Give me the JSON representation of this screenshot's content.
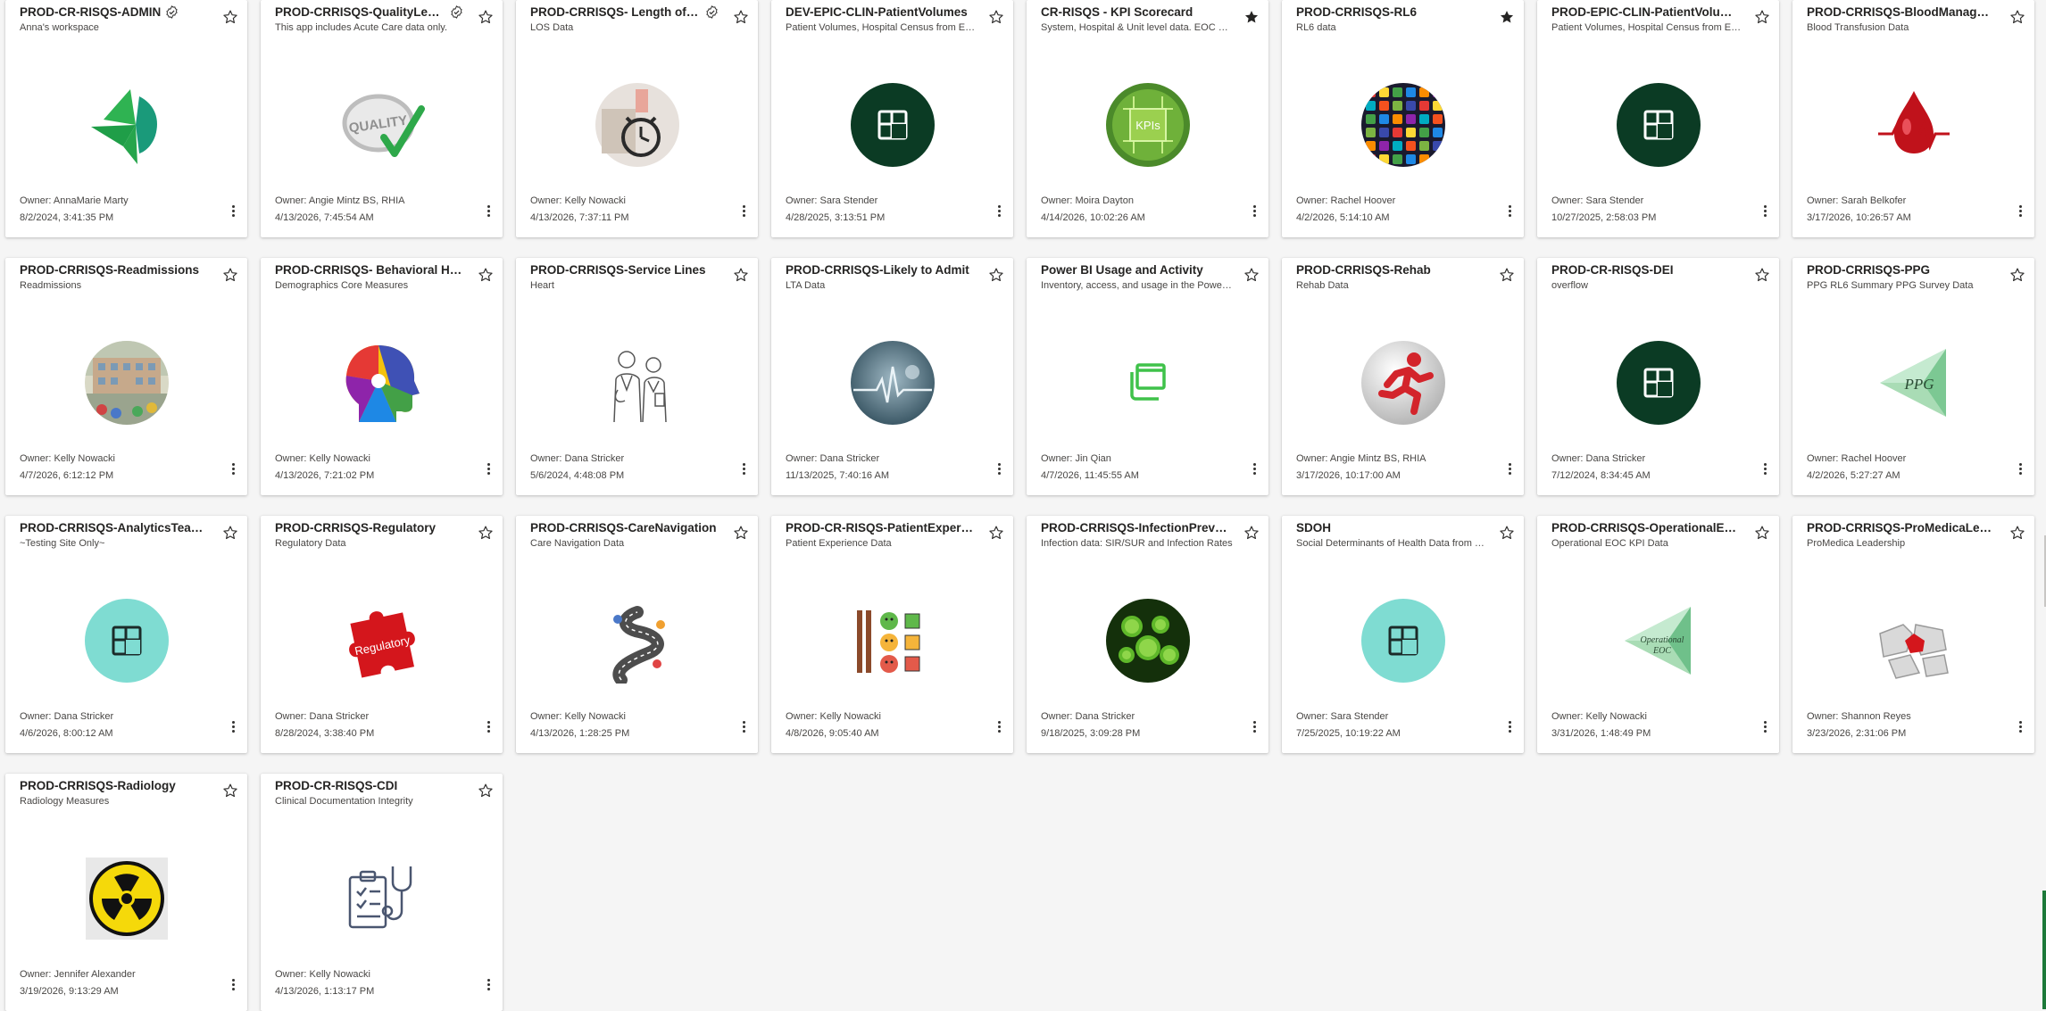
{
  "labels": {
    "owner_prefix": "Owner: "
  },
  "apps": [
    {
      "title": "PROD-CR-RISQS-ADMIN",
      "certified": true,
      "favorite": false,
      "description": "Anna's workspace",
      "owner": "AnnaMarie Marty",
      "date": "8/2/2024, 3:41:35 PM",
      "icon": "green-arrow-logo-icon"
    },
    {
      "title": "PROD-CRRISQS-QualityLeads",
      "certified": true,
      "favorite": false,
      "description": "This app includes Acute Care data only.",
      "owner": "Angie Mintz BS, RHIA",
      "date": "4/13/2026, 7:45:54 AM",
      "icon": "quality-checkmark-icon"
    },
    {
      "title": "PROD-CRRISQS- Length of Stay",
      "certified": true,
      "favorite": false,
      "description": "LOS Data",
      "owner": "Kelly Nowacki",
      "date": "4/13/2026, 7:37:11 PM",
      "icon": "alarm-clock-photo-icon"
    },
    {
      "title": "DEV-EPIC-CLIN-PatientVolumes",
      "certified": false,
      "favorite": false,
      "description": "Patient Volumes, Hospital Census from Epic",
      "owner": "Sara Stender",
      "date": "4/28/2025, 3:13:51 PM",
      "icon": "app-default-dark-icon"
    },
    {
      "title": "CR-RISQS - KPI Scorecard",
      "certified": false,
      "favorite": true,
      "description": "System, Hospital & Unit level data. EOC Reports",
      "owner": "Moira Dayton",
      "date": "4/14/2026, 10:02:26 AM",
      "icon": "kpi-chip-icon"
    },
    {
      "title": "PROD-CRRISQS-RL6",
      "certified": false,
      "favorite": true,
      "description": "RL6 data",
      "owner": "Rachel Hoover",
      "date": "4/2/2026, 5:14:10 AM",
      "icon": "app-grid-photo-icon"
    },
    {
      "title": "PROD-EPIC-CLIN-PatientVolumes",
      "certified": false,
      "favorite": false,
      "description": "Patient Volumes, Hospital Census from Epic",
      "owner": "Sara Stender",
      "date": "10/27/2025, 2:58:03 PM",
      "icon": "app-default-dark-icon"
    },
    {
      "title": "PROD-CRRISQS-BloodManagement",
      "certified": false,
      "favorite": false,
      "description": "Blood Transfusion Data",
      "owner": "Sarah Belkofer",
      "date": "3/17/2026, 10:26:57 AM",
      "icon": "blood-drop-icon"
    },
    {
      "title": "PROD-CRRISQS-Readmissions",
      "certified": false,
      "favorite": false,
      "description": "Readmissions",
      "owner": "Kelly Nowacki",
      "date": "4/7/2026, 6:12:12 PM",
      "icon": "hospital-building-icon"
    },
    {
      "title": "PROD-CRRISQS- Behavioral Health",
      "certified": false,
      "favorite": false,
      "description": "Demographics Core Measures",
      "owner": "Kelly Nowacki",
      "date": "4/13/2026, 7:21:02 PM",
      "icon": "colorful-head-icon"
    },
    {
      "title": "PROD-CRRISQS-Service Lines",
      "certified": false,
      "favorite": false,
      "description": "Heart",
      "owner": "Dana Stricker",
      "date": "5/6/2024, 4:48:08 PM",
      "icon": "doctors-sketch-icon"
    },
    {
      "title": "PROD-CRRISQS-Likely to Admit",
      "certified": false,
      "favorite": false,
      "description": "LTA Data",
      "owner": "Dana Stricker",
      "date": "11/13/2025, 7:40:16 AM",
      "icon": "heartbeat-photo-icon"
    },
    {
      "title": "Power BI Usage and Activity",
      "certified": false,
      "favorite": false,
      "description": "Inventory, access, and usage in the Power BI tenant",
      "owner": "Jin Qian",
      "date": "4/7/2026, 11:45:55 AM",
      "icon": "stacked-windows-icon"
    },
    {
      "title": "PROD-CRRISQS-Rehab",
      "certified": false,
      "favorite": false,
      "description": "Rehab Data",
      "owner": "Angie Mintz BS, RHIA",
      "date": "3/17/2026, 10:17:00 AM",
      "icon": "running-man-icon"
    },
    {
      "title": "PROD-CR-RISQS-DEI",
      "certified": false,
      "favorite": false,
      "description": "overflow",
      "owner": "Dana Stricker",
      "date": "7/12/2024, 8:34:45 AM",
      "icon": "app-default-dark-icon"
    },
    {
      "title": "PROD-CRRISQS-PPG",
      "certified": false,
      "favorite": false,
      "description": "PPG RL6 Summary PPG Survey Data",
      "owner": "Rachel Hoover",
      "date": "4/2/2026, 5:27:27 AM",
      "icon": "ppg-triangle-icon"
    },
    {
      "title": "PROD-CRRISQS-AnalyticsTeamOnly",
      "certified": false,
      "favorite": false,
      "description": "~Testing Site Only~",
      "owner": "Dana Stricker",
      "date": "4/6/2026, 8:00:12 AM",
      "icon": "app-default-teal-icon"
    },
    {
      "title": "PROD-CRRISQS-Regulatory",
      "certified": false,
      "favorite": false,
      "description": "Regulatory Data",
      "owner": "Dana Stricker",
      "date": "8/28/2024, 3:38:40 PM",
      "icon": "regulatory-puzzle-icon"
    },
    {
      "title": "PROD-CRRISQS-CareNavigation",
      "certified": false,
      "favorite": false,
      "description": "Care Navigation Data",
      "owner": "Kelly Nowacki",
      "date": "4/13/2026, 1:28:25 PM",
      "icon": "winding-road-icon"
    },
    {
      "title": "PROD-CR-RISQS-PatientExperience",
      "certified": false,
      "favorite": false,
      "description": "Patient Experience Data",
      "owner": "Kelly Nowacki",
      "date": "4/8/2026, 9:05:40 AM",
      "icon": "smiley-feedback-icon"
    },
    {
      "title": "PROD-CRRISQS-InfectionPrevention",
      "certified": false,
      "favorite": false,
      "description": "Infection data: SIR/SUR and Infection Rates",
      "owner": "Dana Stricker",
      "date": "9/18/2025, 3:09:28 PM",
      "icon": "virus-icon"
    },
    {
      "title": "SDOH",
      "certified": false,
      "favorite": false,
      "description": "Social Determinants of Health Data from Epic",
      "owner": "Sara Stender",
      "date": "7/25/2025, 10:19:22 AM",
      "icon": "app-default-teal-icon"
    },
    {
      "title": "PROD-CRRISQS-OperationalEOC",
      "certified": false,
      "favorite": false,
      "description": "Operational EOC KPI Data",
      "owner": "Kelly Nowacki",
      "date": "3/31/2026, 1:48:49 PM",
      "icon": "operational-eoc-triangle-icon"
    },
    {
      "title": "PROD-CRRISQS-ProMedicaLeadership",
      "certified": false,
      "favorite": false,
      "description": "ProMedica Leadership",
      "owner": "Shannon Reyes",
      "date": "3/23/2026, 2:31:06 PM",
      "icon": "puzzle-gear-icon"
    },
    {
      "title": "PROD-CRRISQS-Radiology",
      "certified": false,
      "favorite": false,
      "description": "Radiology Measures",
      "owner": "Jennifer Alexander",
      "date": "3/19/2026, 9:13:29 AM",
      "icon": "radiation-icon"
    },
    {
      "title": "PROD-CR-RISQS-CDI",
      "certified": false,
      "favorite": false,
      "description": "Clinical Documentation Integrity",
      "owner": "Kelly Nowacki",
      "date": "4/13/2026, 1:13:17 PM",
      "icon": "clipboard-stethoscope-icon"
    }
  ],
  "thumb_text": {
    "quality": "QUALITY",
    "kpi": "KPIs",
    "ppg": "PPG",
    "regulatory": "Regulatory",
    "operational_eoc": "Operational EOC"
  },
  "colors": {
    "dark_green": "#0b3b24",
    "teal": "#7fdcd2",
    "fav_star": "#252423"
  }
}
